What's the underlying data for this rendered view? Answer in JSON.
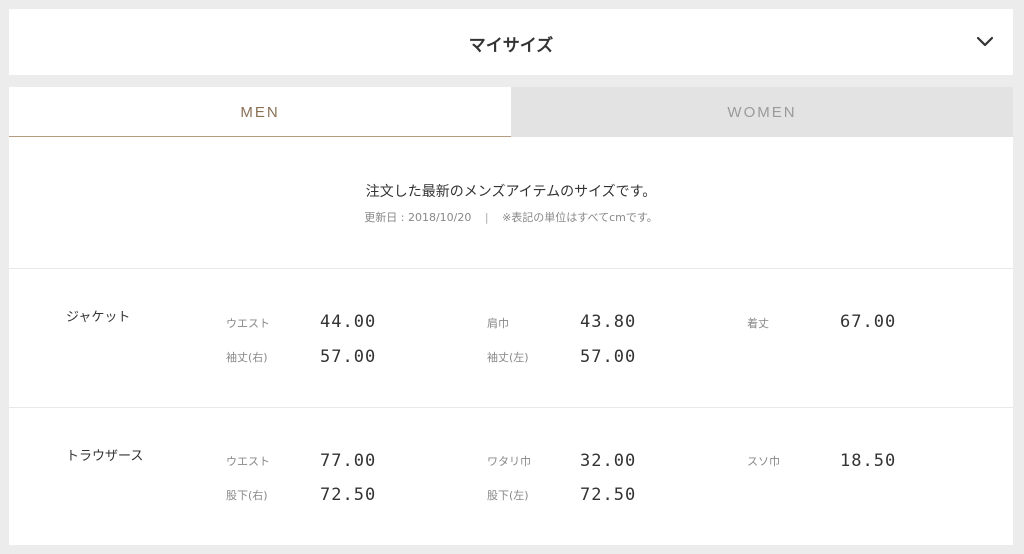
{
  "header": {
    "title": "マイサイズ",
    "toggle_icon": "chevron-down-icon"
  },
  "tabs": [
    {
      "label": "MEN",
      "active": true
    },
    {
      "label": "WOMEN",
      "active": false
    }
  ],
  "intro": {
    "message": "注文した最新のメンズアイテムのサイズです。",
    "updated": "更新日 : 2018/10/20",
    "separator": "|",
    "unit_note": "※表記の単位はすべてcmです。"
  },
  "items": [
    {
      "name": "ジャケット",
      "measurements": [
        {
          "label": "ウエスト",
          "value": "44.00"
        },
        {
          "label": "肩巾",
          "value": "43.80"
        },
        {
          "label": "着丈",
          "value": "67.00"
        },
        {
          "label": "袖丈(右)",
          "value": "57.00"
        },
        {
          "label": "袖丈(左)",
          "value": "57.00"
        }
      ]
    },
    {
      "name": "トラウザース",
      "measurements": [
        {
          "label": "ウエスト",
          "value": "77.00"
        },
        {
          "label": "ワタリ巾",
          "value": "32.00"
        },
        {
          "label": "スソ巾",
          "value": "18.50"
        },
        {
          "label": "股下(右)",
          "value": "72.50"
        },
        {
          "label": "股下(左)",
          "value": "72.50"
        }
      ]
    }
  ],
  "colors": {
    "accent": "#8a7156",
    "accent_line": "#b89b7f",
    "inactive_tab_bg": "#e3e3e3",
    "background": "#ececec"
  }
}
